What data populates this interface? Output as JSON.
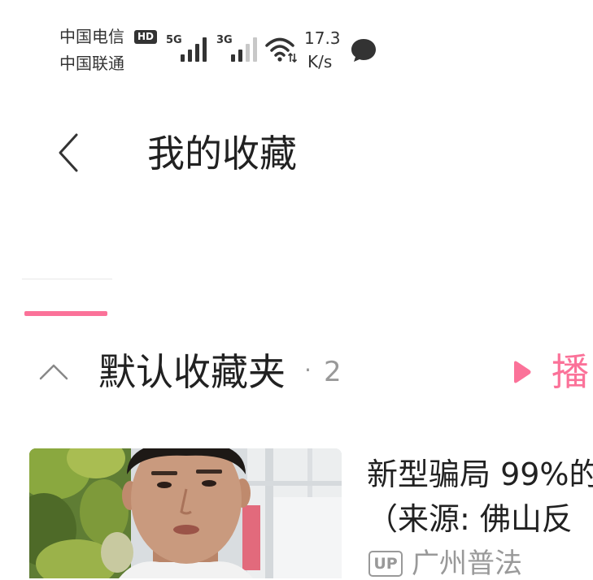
{
  "status_bar": {
    "carrier_primary": "中国电信",
    "hd_badge": "HD",
    "carrier_secondary": "中国联通",
    "network_primary": "5G",
    "network_secondary": "3G",
    "signal_primary_level": 4,
    "signal_secondary_level": 2,
    "net_speed": "17.3",
    "net_speed_unit": "K/s",
    "icons": {
      "wifi": "wifi-icon",
      "message": "message-bubble-icon"
    }
  },
  "header": {
    "back_icon": "chevron-left-icon",
    "title": "我的收藏"
  },
  "folder": {
    "collapse_icon": "chevron-up-icon",
    "name": "默认收藏夹",
    "separator": "·",
    "count": "2",
    "play_icon": "play-icon",
    "play_all_label": "播"
  },
  "videos": [
    {
      "title_lines": [
        "新型骗局 99%的",
        "（来源: 佛山反"
      ],
      "up_badge": "UP",
      "uploader": "广州普法"
    }
  ],
  "colors": {
    "accent": "#fb7299",
    "text_primary": "#212121",
    "text_secondary": "#999999",
    "status_text": "#333333"
  }
}
